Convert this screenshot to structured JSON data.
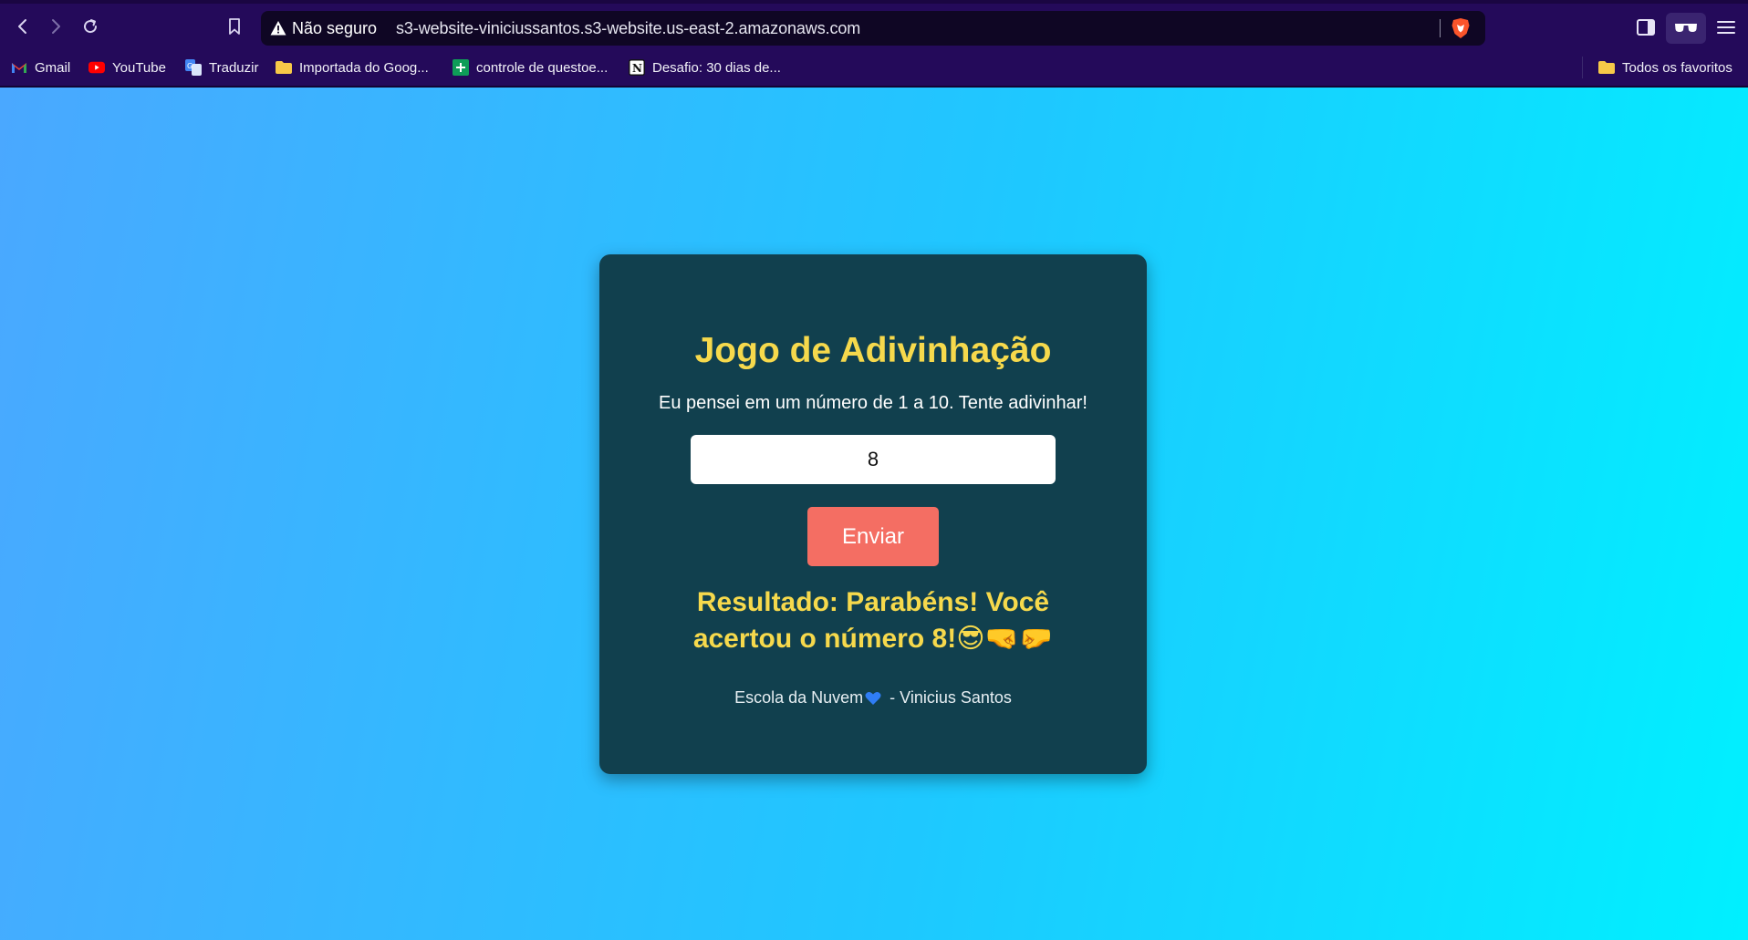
{
  "browser": {
    "security_label": "Não seguro",
    "url": "s3-website-viniciussantos.s3-website.us-east-2.amazonaws.com",
    "icons": [
      "back-icon",
      "forward-icon",
      "reload-icon",
      "bookmark-icon",
      "warning-icon",
      "brave-shields-icon",
      "sidebar-icon",
      "reader-mode-icon",
      "menu-icon"
    ],
    "bookmarks": [
      {
        "label": "Gmail",
        "icon": "gmail-icon"
      },
      {
        "label": "YouTube",
        "icon": "youtube-icon"
      },
      {
        "label": "Traduzir",
        "icon": "translate-icon"
      },
      {
        "label": "Importada do Goog...",
        "icon": "folder-icon"
      },
      {
        "label": "controle de questoe...",
        "icon": "sheets-icon"
      },
      {
        "label": "Desafio: 30 dias de...",
        "icon": "notion-icon"
      }
    ],
    "all_bookmarks_label": "Todos os favoritos"
  },
  "game": {
    "title": "Jogo de Adivinhação",
    "intro": "Eu pensei em um número de 1 a 10. Tente adivinhar!",
    "guess_value": "8",
    "submit_label": "Enviar",
    "result": "Resultado: Parabéns! Você acertou o número 8!😎🤜🤛",
    "footer_left": "Escola da Nuvem",
    "footer_right": " - Vinicius Santos"
  },
  "colors": {
    "chrome": "#240a5a",
    "card": "#11404e",
    "title": "#f6d94c",
    "button": "#f46e63"
  }
}
